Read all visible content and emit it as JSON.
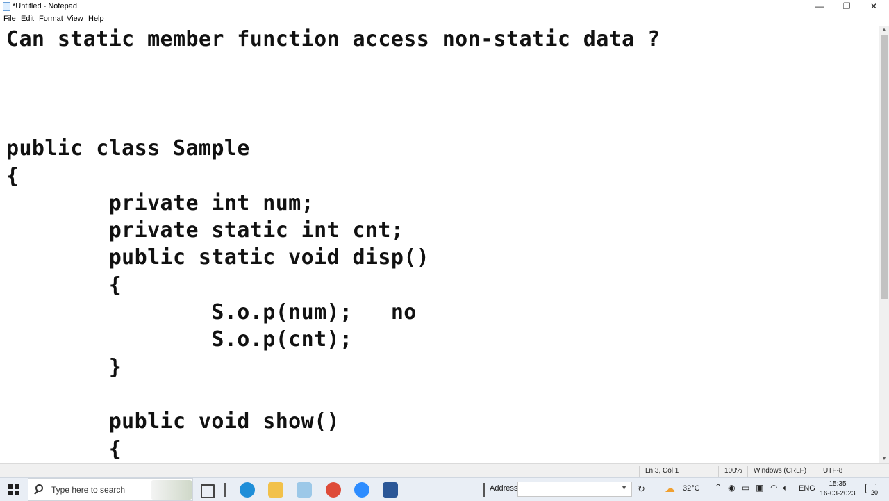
{
  "window": {
    "title": "*Untitled - Notepad",
    "minimize_glyph": "—",
    "maximize_glyph": "❐",
    "close_glyph": "✕"
  },
  "menu": {
    "file": "File",
    "edit": "Edit",
    "format": "Format",
    "view": "View",
    "help": "Help"
  },
  "document": {
    "lines": [
      "Can static member function access non-static data ?",
      "public class Sample",
      "{",
      "        private int num;",
      "        private static int cnt;",
      "        public static void disp()",
      "        {",
      "                S.o.p(num);   no",
      "                S.o.p(cnt);",
      "        }",
      "        public void show()",
      "        {"
    ]
  },
  "status": {
    "position": "Ln 3, Col 1",
    "zoom": "100%",
    "line_ending": "Windows (CRLF)",
    "encoding": "UTF-8"
  },
  "taskbar": {
    "search_placeholder": "Type here to search",
    "address_label": "Address",
    "address_value": "",
    "weather": "32°C",
    "language": "ENG",
    "time": "15:35",
    "date": "16-03-2023",
    "notification_count": "20",
    "colors": {
      "edge": "#1f8ed8",
      "explorer": "#f2c14a",
      "chrome": "#de4b39",
      "zoom": "#2d8cff",
      "word": "#2b5797"
    }
  }
}
